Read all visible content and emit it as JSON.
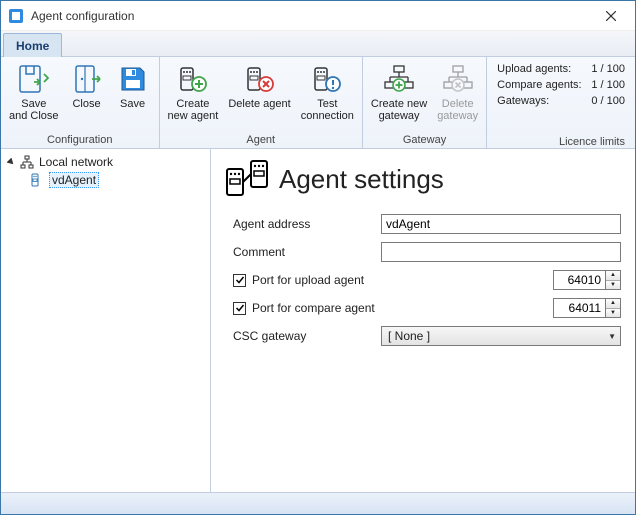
{
  "title": "Agent configuration",
  "tabs": {
    "home": "Home"
  },
  "ribbon": {
    "configuration": {
      "label": "Configuration",
      "save_and_close": "Save\nand Close",
      "close": "Close",
      "save": "Save"
    },
    "agent": {
      "label": "Agent",
      "create_new": "Create\nnew agent",
      "delete": "Delete agent",
      "test_conn": "Test\nconnection"
    },
    "gateway": {
      "label": "Gateway",
      "create_new": "Create new\ngateway",
      "delete": "Delete\ngateway"
    },
    "license": {
      "label": "Licence limits",
      "upload_label": "Upload agents:",
      "upload_value": "1 / 100",
      "compare_label": "Compare agents:",
      "compare_value": "1 / 100",
      "gateways_label": "Gateways:",
      "gateways_value": "0 / 100"
    }
  },
  "tree": {
    "root": "Local network",
    "child": "vdAgent"
  },
  "content": {
    "heading": "Agent settings",
    "address_label": "Agent address",
    "address_value": "vdAgent",
    "comment_label": "Comment",
    "comment_value": "",
    "port_upload_label": "Port for upload agent",
    "port_upload_value": "64010",
    "port_compare_label": "Port for compare agent",
    "port_compare_value": "64011",
    "csc_label": "CSC gateway",
    "csc_value": "[ None ]"
  },
  "colors": {
    "accent": "#2e75b6",
    "green": "#3fa64a",
    "red": "#d83b3b",
    "blue_info": "#2e75b6"
  }
}
